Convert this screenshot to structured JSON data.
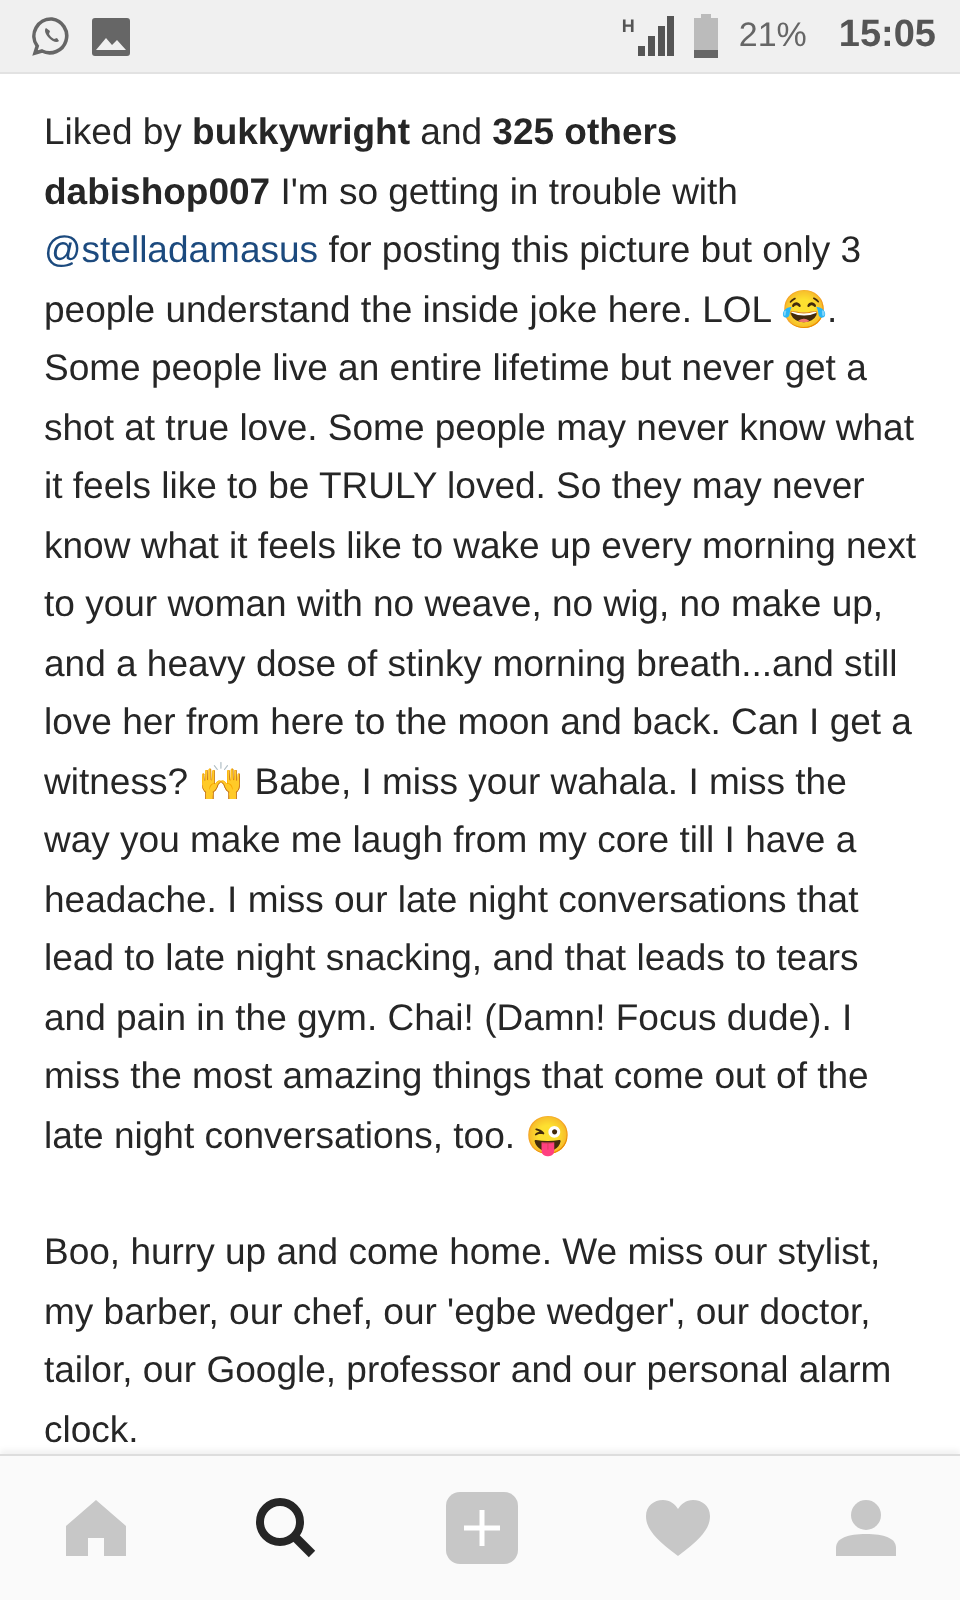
{
  "status_bar": {
    "battery": "21%",
    "time": "15:05",
    "network": "H"
  },
  "post": {
    "liked_by_prefix": "Liked by",
    "liked_by_user": "bukkywright",
    "liked_by_join": "and",
    "liked_by_others": "325 others",
    "username": "dabishop007",
    "caption_before": "I'm so getting in trouble with",
    "mention": "@stelladamasus",
    "caption_after": "for posting this picture but only 3 people understand the inside joke here. LOL 😂. Some people live an entire lifetime but never get a shot at true love. Some people may never know what it feels like to be TRULY loved. So they may never know what it feels like to wake up every morning next to your woman with no weave, no wig, no make up, and a heavy dose of stinky morning breath...and still love her from here to the moon and back. Can I get a witness? 🙌 Babe, I miss your wahala. I miss the way you make me laugh from my core till I have a headache. I miss our late night conversations that lead to late night snacking, and that leads to tears and pain in the gym. Chai! (Damn! Focus dude). I miss the most amazing things that come out of the late night conversations, too. 😜",
    "caption_2": "Boo, hurry up and come home. We miss our stylist, my barber, our chef, our 'egbe wedger', our doctor, tailor, our Google, professor and our personal alarm clock."
  },
  "nav": [
    {
      "kind": "home",
      "selected": false
    },
    {
      "kind": "search",
      "selected": true
    },
    {
      "kind": "add",
      "selected": false
    },
    {
      "kind": "activity",
      "selected": false
    },
    {
      "kind": "profile",
      "selected": false
    }
  ]
}
